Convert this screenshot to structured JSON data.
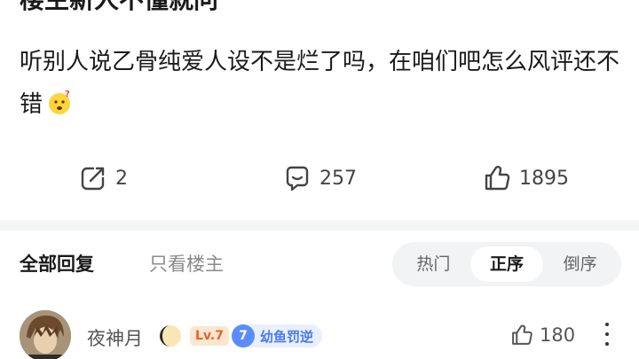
{
  "post": {
    "title": "楼主新人不懂就问",
    "body": "听别人说乙骨纯爱人设不是烂了吗，在咱们吧怎么风评还不错",
    "emoji": "thinking-face-emoji"
  },
  "actions": {
    "share": {
      "icon": "share-icon",
      "count": "2"
    },
    "comment": {
      "icon": "comment-icon",
      "count": "257"
    },
    "like": {
      "icon": "thumbs-up-icon",
      "count": "1895"
    }
  },
  "reply_filter": {
    "all_label": "全部回复",
    "op_only_label": "只看楼主",
    "sort_options": [
      "热门",
      "正序",
      "倒序"
    ],
    "active_sort": "正序"
  },
  "first_comment": {
    "username": "夜神月",
    "level_badge": "Lv.7",
    "fan_level": "7",
    "fan_badge_name": "幼鱼罚逆",
    "like_count": "180",
    "colors": {
      "level_badge_text": "#e5632a",
      "fan_badge": "#5b8cff"
    }
  }
}
